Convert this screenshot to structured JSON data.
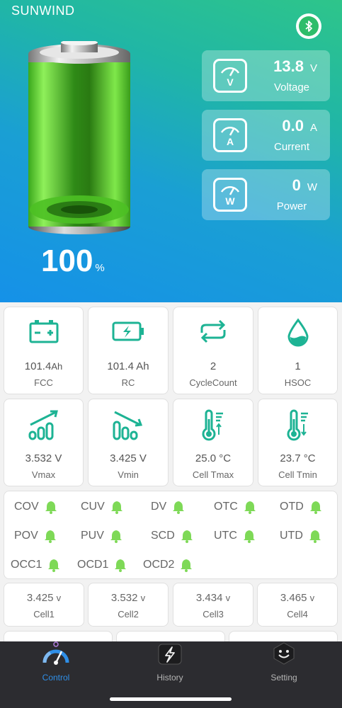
{
  "header": {
    "brand": "SUNWIND",
    "bluetooth_icon": "bluetooth-icon"
  },
  "battery": {
    "soc_value": "100",
    "soc_unit": "%",
    "level": 1.0,
    "color": "#5bd62a"
  },
  "meters": [
    {
      "icon": "voltmeter-icon",
      "letter": "V",
      "value": "13.8",
      "unit": "V",
      "label": "Voltage"
    },
    {
      "icon": "ammeter-icon",
      "letter": "A",
      "value": "0.0",
      "unit": "A",
      "label": "Current"
    },
    {
      "icon": "wattmeter-icon",
      "letter": "W",
      "value": "0",
      "unit": "W",
      "label": "Power"
    }
  ],
  "stats_row1": [
    {
      "icon": "battery-terminals-icon",
      "value": "101.4",
      "unit": "Ah",
      "label": "FCC"
    },
    {
      "icon": "battery-charging-icon",
      "value": "101.4 Ah",
      "unit": "",
      "label": "RC"
    },
    {
      "icon": "cycle-arrows-icon",
      "value": "2",
      "unit": "",
      "label": "CycleCount"
    },
    {
      "icon": "water-drop-icon",
      "value": "1",
      "unit": "",
      "label": "HSOC"
    }
  ],
  "stats_row2": [
    {
      "icon": "trend-up-icon",
      "value": "3.532 V",
      "label": "Vmax"
    },
    {
      "icon": "trend-down-icon",
      "value": "3.425 V",
      "label": "Vmin"
    },
    {
      "icon": "thermometer-up-icon",
      "value": "25.0 °C",
      "label": "Cell Tmax"
    },
    {
      "icon": "thermometer-down-icon",
      "value": "23.7 °C",
      "label": "Cell Tmin"
    }
  ],
  "alarms": [
    "COV",
    "CUV",
    "DV",
    "OTC",
    "OTD",
    "POV",
    "PUV",
    "SCD",
    "UTC",
    "UTD",
    "OCC1",
    "OCD1",
    "OCD2"
  ],
  "alarm_color": "#7ed957",
  "cells": [
    {
      "value": "3.425",
      "unit": "v",
      "label": "Cell1"
    },
    {
      "value": "3.532",
      "unit": "v",
      "label": "Cell2"
    },
    {
      "value": "3.434",
      "unit": "v",
      "label": "Cell3"
    },
    {
      "value": "3.465",
      "unit": "v",
      "label": "Cell4"
    }
  ],
  "tabs": [
    {
      "label": "Control",
      "icon": "gauge-icon",
      "active": true
    },
    {
      "label": "History",
      "icon": "lightning-icon",
      "active": false
    },
    {
      "label": "Setting",
      "icon": "smiley-icon",
      "active": false
    }
  ],
  "colors": {
    "accent": "#1db394",
    "tab_active": "#2f8fe8"
  }
}
